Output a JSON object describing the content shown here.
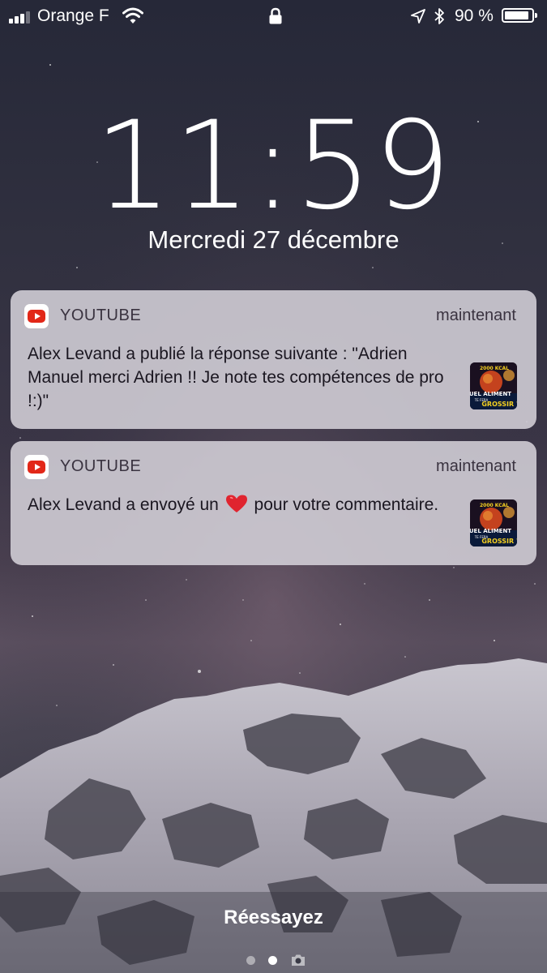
{
  "status_bar": {
    "carrier": "Orange F",
    "battery_percent": "90 %",
    "battery_level": 0.9,
    "signal_bars": 3,
    "signal_bars_total": 4,
    "icons": [
      "signal-icon",
      "wifi-icon",
      "lock-icon",
      "location-arrow-icon",
      "bluetooth-icon",
      "battery-icon"
    ]
  },
  "lock_screen": {
    "time": "11:59",
    "date": "Mercredi 27 décembre"
  },
  "notifications": [
    {
      "app": "YOUTUBE",
      "time": "maintenant",
      "body": "Alex Levand a publié la réponse suivante : \"Adrien Manuel merci Adrien !! Je note tes compétences de pro !:)\"",
      "thumbnail": {
        "top_text": "2000 KCAL",
        "middle_text": "QUEL ALIMENT",
        "small_text": "TE FERA",
        "bottom_text": "GROSSIR ?"
      }
    },
    {
      "app": "YOUTUBE",
      "time": "maintenant",
      "body_before": "Alex Levand a envoyé un",
      "body_after": "pour votre commentaire.",
      "emoji": "heart-icon",
      "thumbnail": {
        "top_text": "2000 KCAL",
        "middle_text": "QUEL ALIMENT",
        "small_text": "TE FERA",
        "bottom_text": "GROSSIR ?"
      }
    }
  ],
  "bottom": {
    "retry_label": "Réessayez",
    "page_dots": 2,
    "active_page": 1,
    "camera_icon": "camera-icon"
  },
  "colors": {
    "youtube_red": "#e22718",
    "notification_bg": "#d4d0d8",
    "heart": "#e0242f"
  }
}
